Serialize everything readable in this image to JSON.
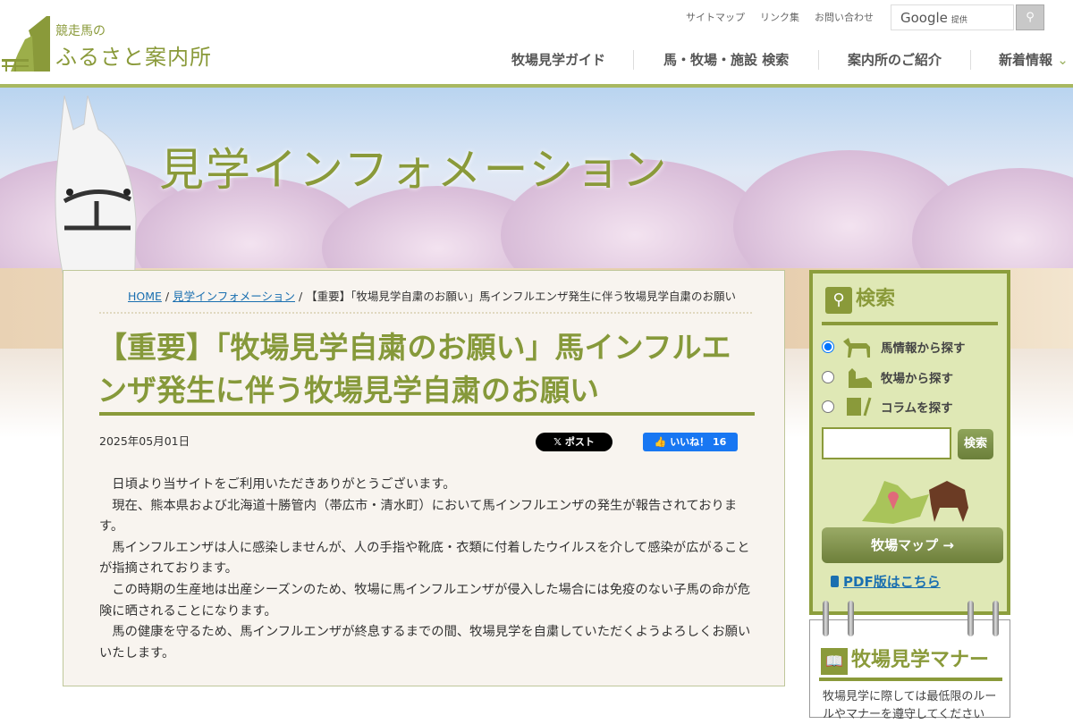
{
  "header": {
    "logo_small": "競走馬の",
    "logo_big": "ふるさと案内所",
    "util_links": [
      "サイトマップ",
      "リンク集",
      "お問い合わせ"
    ],
    "search_brand": "Google",
    "search_suffix": "提供",
    "nav": [
      "牧場見学ガイド",
      "馬・牧場・施設 検索",
      "案内所のご紹介",
      "新着情報"
    ]
  },
  "hero": {
    "title": "見学インフォメーション"
  },
  "breadcrumb": {
    "home": "HOME",
    "section": "見学インフォメーション",
    "current": "【重要】「牧場見学自粛のお願い」馬インフルエンザ発生に伴う牧場見学自粛のお願い"
  },
  "article": {
    "title": "【重要】「牧場見学自粛のお願い」馬インフルエンザ発生に伴う牧場見学自粛のお願い",
    "date": "2025年05月01日",
    "x_post": "ポスト",
    "fb_like": "いいね！",
    "fb_count": "16",
    "paragraphs": [
      "日頃より当サイトをご利用いただきありがとうございます。",
      "現在、熊本県および北海道十勝管内（帯広市・清水町）において馬インフルエンザの発生が報告されております。",
      "馬インフルエンザは人に感染しませんが、人の手指や靴底・衣類に付着したウイルスを介して感染が広がることが指摘されております。",
      "この時期の生産地は出産シーズンのため、牧場に馬インフルエンザが侵入した場合には免疫のない子馬の命が危険に晒されることになります。",
      "馬の健康を守るため、馬インフルエンザが終息するまでの間、牧場見学を自粛していただくようよろしくお願いいたします。"
    ]
  },
  "sidebar": {
    "search_title": "検索",
    "options": [
      "馬情報から探す",
      "牧場から探す",
      "コラムを探す"
    ],
    "selected_option": 0,
    "search_value": "",
    "search_button": "検索",
    "map_button": "牧場マップ →",
    "pdf_link": "PDF版はこちら",
    "manner_title": "牧場見学マナー",
    "manner_text": "牧場見学に際しては最低限のルールやマナーを遵守してください"
  },
  "colors": {
    "accent": "#8a9a3a",
    "sidebar_bg": "#dfe8b5",
    "link": "#1a6fb0"
  }
}
